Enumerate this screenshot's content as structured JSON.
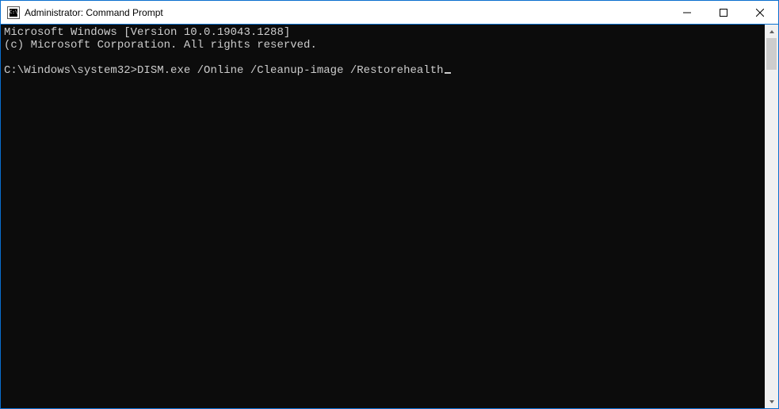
{
  "window": {
    "title": "Administrator: Command Prompt",
    "icon_label": "C:\\"
  },
  "terminal": {
    "header_line1": "Microsoft Windows [Version 10.0.19043.1288]",
    "header_line2": "(c) Microsoft Corporation. All rights reserved.",
    "prompt": "C:\\Windows\\system32>",
    "command": "DISM.exe /Online /Cleanup-image /Restorehealth"
  }
}
